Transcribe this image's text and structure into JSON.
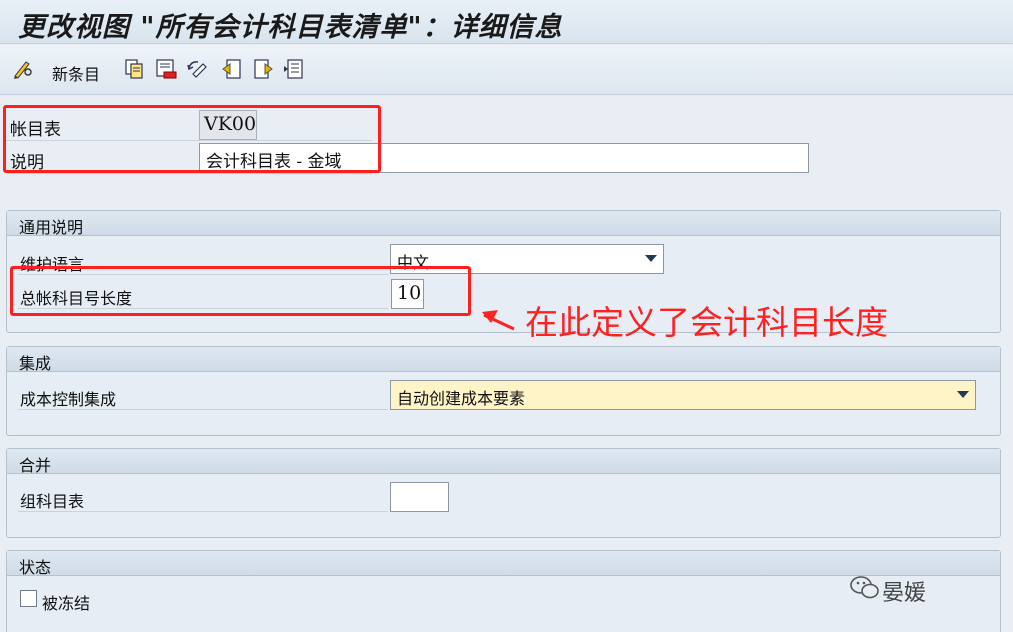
{
  "window": {
    "title": "更改视图 \"所有会计科目表清单\"：详细信息"
  },
  "toolbar": {
    "new_entry_label": "新条目"
  },
  "header": {
    "coa_label": "帐目表",
    "coa_value": "VK00",
    "desc_label": "说明",
    "desc_value": "会计科目表 - 金域"
  },
  "general": {
    "title": "通用说明",
    "maint_lang_label": "维护语言",
    "maint_lang_value": "中文",
    "gl_length_label": "总帐科目号长度",
    "gl_length_value": "10"
  },
  "integration": {
    "title": "集成",
    "co_label": "成本控制集成",
    "co_value": "自动创建成本要素"
  },
  "consolidation": {
    "title": "合并",
    "group_coa_label": "组科目表",
    "group_coa_value": ""
  },
  "status": {
    "title": "状态",
    "blocked_label": "被冻结",
    "blocked_checked": false
  },
  "annotation": {
    "text": "在此定义了会计科目长度"
  },
  "watermark": {
    "text": "晏媛"
  },
  "colors": {
    "annotation_red": "#ff1f1f",
    "highlight_yellow": "#fff3c8"
  }
}
